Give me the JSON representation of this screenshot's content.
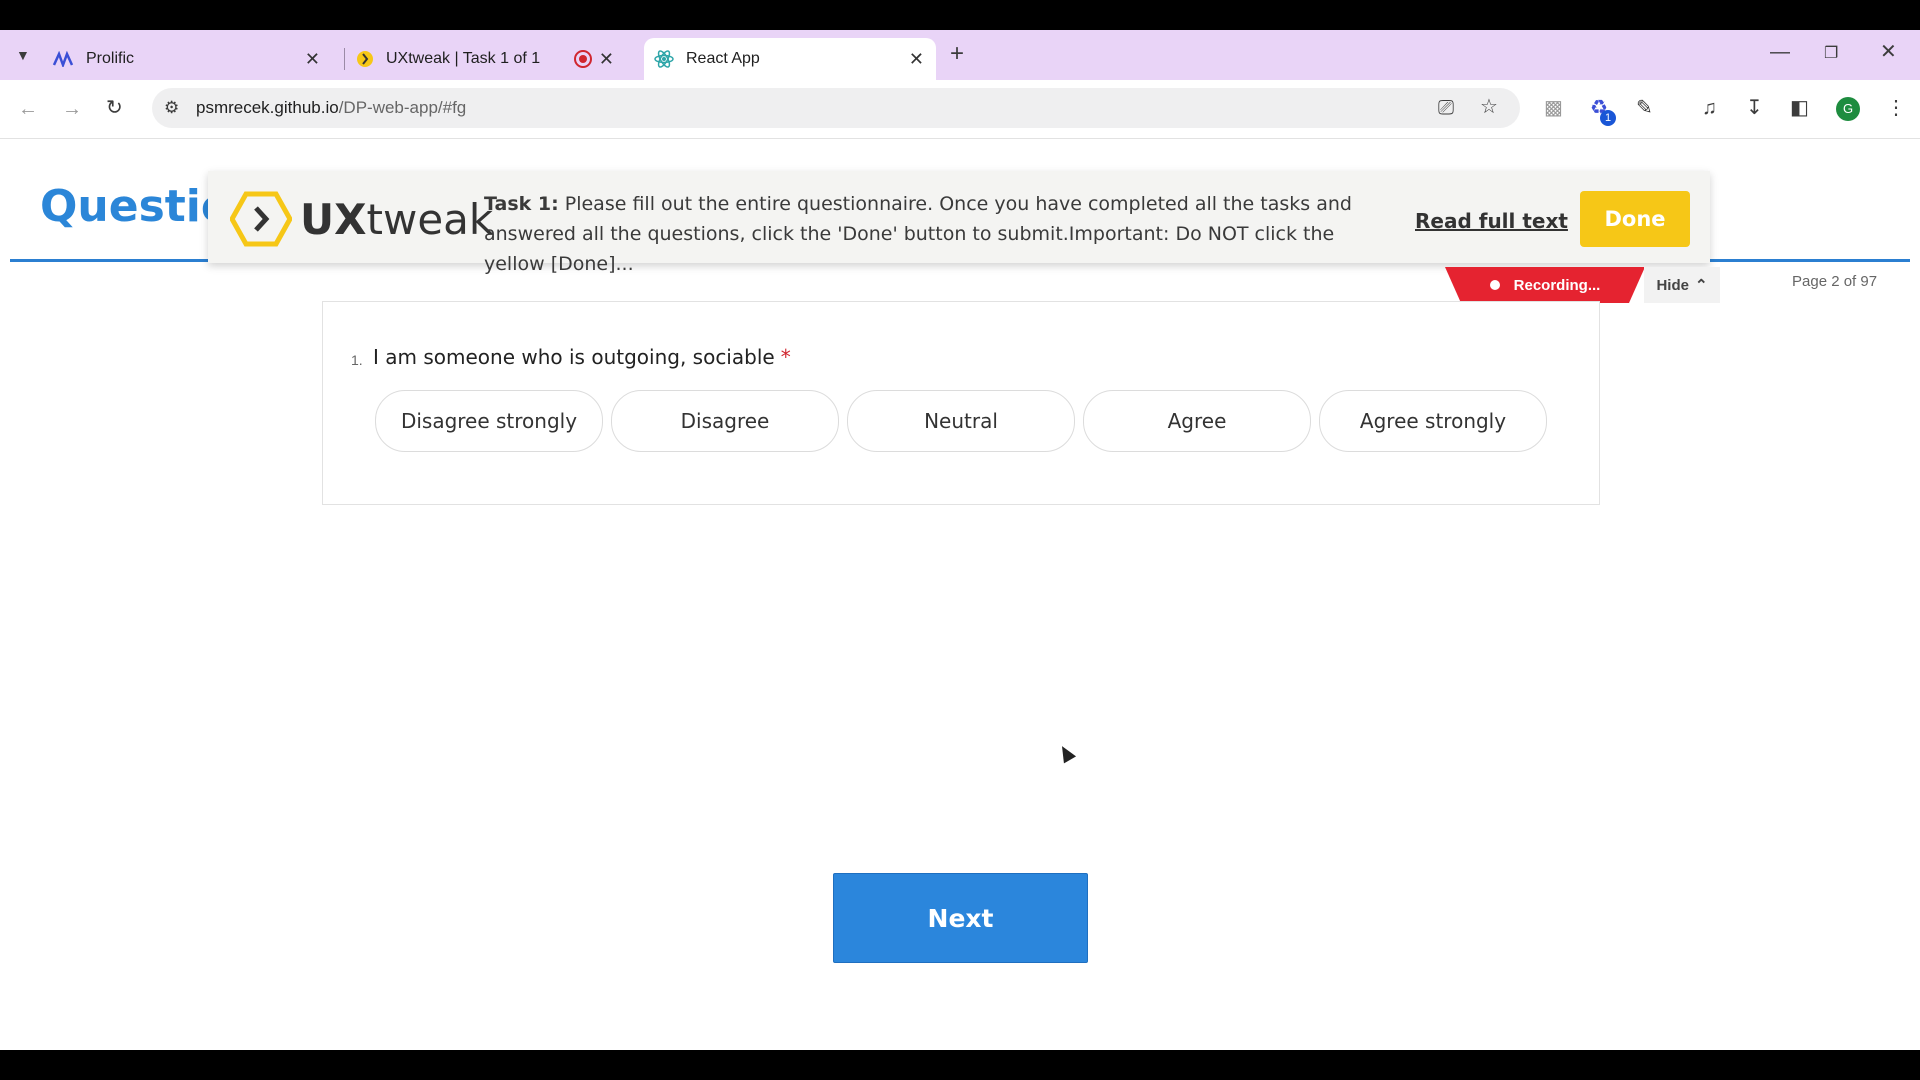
{
  "browser": {
    "tabs": [
      {
        "title": "Prolific"
      },
      {
        "title": "UXtweak | Task 1 of 1"
      },
      {
        "title": "React App"
      }
    ],
    "url_host": "psmrecek.github.io",
    "url_path": "/DP-web-app/#fg",
    "profile_initial": "G",
    "extension_badge": "1"
  },
  "page": {
    "title": "Questior",
    "page_info": "Page 2 of 97"
  },
  "uxtweak": {
    "brand_ux": "UX",
    "brand_tweak": "tweak",
    "task_label": "Task 1:",
    "task_text": " Please fill out the entire questionnaire. Once you have completed all the tasks and answered all the questions, click the 'Done' button to submit.Important: Do NOT click the yellow [Done]...",
    "read_full": "Read full text",
    "done": "Done",
    "recording": "Recording...",
    "hide": "Hide"
  },
  "question": {
    "number": "1.",
    "text": "I am someone who is outgoing, sociable",
    "required_mark": "*",
    "options": [
      "Disagree strongly",
      "Disagree",
      "Neutral",
      "Agree",
      "Agree strongly"
    ]
  },
  "next_label": "Next",
  "colors": {
    "accent": "#2b86dc",
    "done": "#f6c717",
    "recording": "#e52330",
    "tabbar": "#e9d4f7"
  }
}
